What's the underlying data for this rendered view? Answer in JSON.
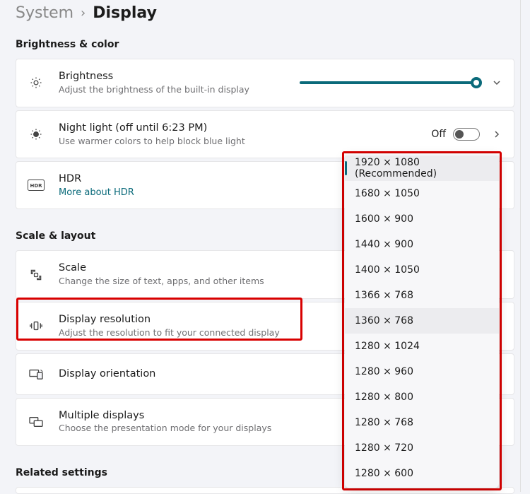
{
  "breadcrumb": {
    "parent": "System",
    "current": "Display"
  },
  "sections": {
    "brightness_color": "Brightness & color",
    "scale_layout": "Scale & layout",
    "related": "Related settings"
  },
  "rows": {
    "brightness": {
      "title": "Brightness",
      "subtitle": "Adjust the brightness of the built-in display"
    },
    "night_light": {
      "title": "Night light (off until 6:23 PM)",
      "subtitle": "Use warmer colors to help block blue light",
      "status": "Off"
    },
    "hdr": {
      "title": "HDR",
      "link": "More about HDR",
      "badge": "HDR"
    },
    "scale": {
      "title": "Scale",
      "subtitle": "Change the size of text, apps, and other items"
    },
    "resolution": {
      "title": "Display resolution",
      "subtitle": "Adjust the resolution to fit your connected display"
    },
    "orientation": {
      "title": "Display orientation"
    },
    "multiple": {
      "title": "Multiple displays",
      "subtitle": "Choose the presentation mode for your displays"
    }
  },
  "slider": {
    "percent": 98
  },
  "resolution_options": [
    "1920 × 1080 (Recommended)",
    "1680 × 1050",
    "1600 × 900",
    "1440 × 900",
    "1400 × 1050",
    "1366 × 768",
    "1360 × 768",
    "1280 × 1024",
    "1280 × 960",
    "1280 × 800",
    "1280 × 768",
    "1280 × 720",
    "1280 × 600"
  ],
  "resolution_selected_index": 0,
  "resolution_hover_index": 6
}
